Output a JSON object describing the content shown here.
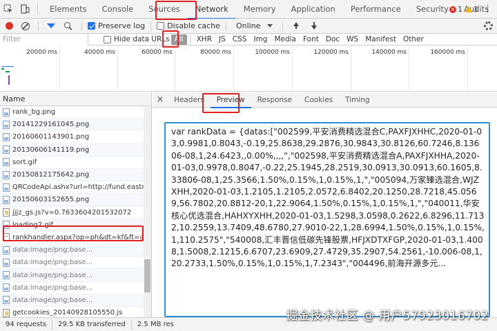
{
  "devtools": {
    "tabs": [
      "Elements",
      "Console",
      "Sources",
      "Network",
      "Memory",
      "Application",
      "Performance",
      "Security",
      "Audits"
    ],
    "active_tab": "Network",
    "error_count": "1",
    "warning_count": "1"
  },
  "toolbar": {
    "preserve_log_label": "Preserve log",
    "preserve_log_checked": true,
    "disable_cache_label": "Disable cache",
    "disable_cache_checked": false,
    "throttle_value": "Online"
  },
  "filter": {
    "placeholder": "Filter",
    "hide_data_urls_label": "Hide data URLs",
    "types": [
      "All",
      "XHR",
      "JS",
      "CSS",
      "Img",
      "Media",
      "Font",
      "Doc",
      "WS",
      "Manifest",
      "Other"
    ],
    "active_type": "All"
  },
  "timeline": {
    "ticks": [
      "20000 ms",
      "40000 ms",
      "60000 ms",
      "80000 ms",
      "100000 ms",
      "120000 ms",
      "140000 ms",
      "160000 ms"
    ]
  },
  "requests": {
    "header": "Name",
    "items": [
      {
        "name": "rank_bg.png",
        "kind": "img"
      },
      {
        "name": "20141229161045.png",
        "kind": "img"
      },
      {
        "name": "20160601143901.png",
        "kind": "img"
      },
      {
        "name": "20130606141119.png",
        "kind": "img"
      },
      {
        "name": "sort.gif",
        "kind": "img"
      },
      {
        "name": "20150812175642.png",
        "kind": "img"
      },
      {
        "name": "QRCodeApi.ashx?url=http://fund.eastmon...",
        "kind": "img"
      },
      {
        "name": "20150603152655.png",
        "kind": "img"
      },
      {
        "name": "jjjz_gs.js?v=0.7633604201532072",
        "kind": "script"
      },
      {
        "name": "loading2.gif",
        "kind": "img"
      },
      {
        "name": "rankhandler.aspx?op=ph&dt=kf&ft=all&r...",
        "kind": "doc"
      },
      {
        "name": "data:image/png;base...",
        "kind": "img"
      },
      {
        "name": "data:image/png;base...",
        "kind": "img"
      },
      {
        "name": "data:image/png;base...",
        "kind": "img"
      },
      {
        "name": "data:image/png;base...",
        "kind": "img"
      },
      {
        "name": "data:image/png;base...",
        "kind": "img"
      },
      {
        "name": "getcookies_20140928105550.js",
        "kind": "script"
      }
    ]
  },
  "details": {
    "tabs": [
      "Headers",
      "Preview",
      "Response",
      "Cookies",
      "Timing"
    ],
    "active_tab": "Preview",
    "preview_text": "var rankData = {datas:[\"002599,平安消费精选混合C,PAXFJXHHC,2020-01-03,0.9981,0.8043,-0.19,25.8638,29.2876,30.9843,30.8126,60.7246,8.13606-08,1,24.6423,,0.00%,,,,\",\"002598,平安消费精选混合A,PAXFJXHHA,2020-01-03,0.9978,0.8047,-0.22,25.1945,28.2519,30.0913,30.0913,60.1605,8.33806-08,1,25.3566,1.50%,0.15%,1,0.15%,1,\",\"005094,万家臻选混合,WJZXHH,2020-01-03,1.2105,1.2105,2.0572,6.8402,20.1250,28.7218,45.0569,56.7802,20.8812-20,1,22.9064,1.50%,0.15%,1,0.15%,1,\",\"040011,华安核心优选混合,HAHXYXHH,2020-01-03,1.5298,3.0598,0.2622,6.8296,11.7132,10.2559,13.7409,48.6780,27.9010-22,1,28.6994,1.50%,0.15%,1,0.15%,1,110.2575\",\"540008,汇丰晋信低碳先锋股票,HFJXDTXFGP,2020-01-03,1.4008,1.5008,2.1215,6.6707,23.6909,27.4729,35.2907,54.2561,-10.006-08,1,20.2733,1.50%,0.15%,1,0.15%,1,7.2343\",\"004496,前海开源多元..."
  },
  "status": {
    "requests": "94 requests",
    "transferred": "29.5 KB transferred",
    "size": "2.5 MB res"
  },
  "watermark": "掘金技术社区 @ 用户5792301670​2",
  "colors": {
    "annotation_red": "#e02020",
    "preview_border": "#2b8fd6",
    "accent_blue": "#1a73e8"
  }
}
